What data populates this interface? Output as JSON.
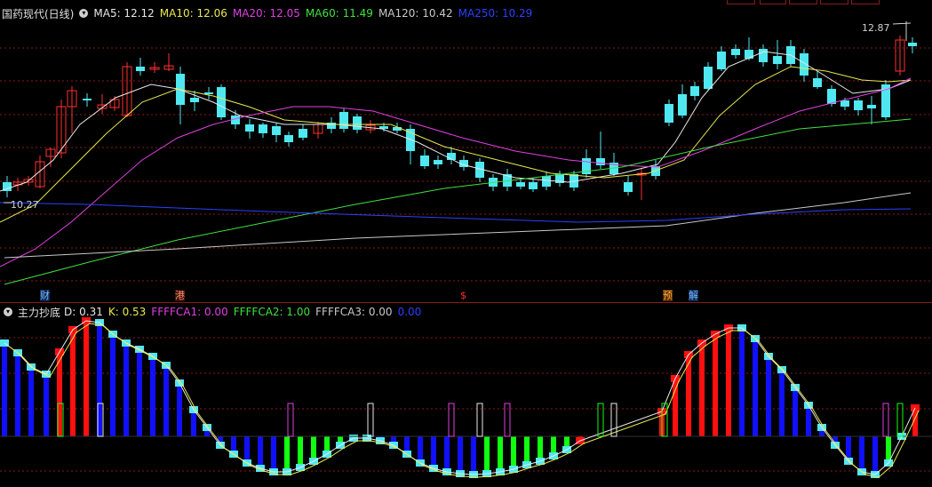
{
  "main_header": {
    "symbol": "国药现代(日线)",
    "indicators": [
      {
        "label": "MA5: 12.12",
        "color": "#e8e8e8"
      },
      {
        "label": "MA10: 12.06",
        "color": "#e8e850"
      },
      {
        "label": "MA20: 12.05",
        "color": "#e040e0"
      },
      {
        "label": "MA60: 11.49",
        "color": "#40e040"
      },
      {
        "label": "MA120: 10.42",
        "color": "#c8c8c8"
      },
      {
        "label": "MA250: 10.29",
        "color": "#2a40ff"
      }
    ]
  },
  "price_labels": {
    "high": "12.87",
    "low": "10.27"
  },
  "event_markers": [
    {
      "text": "财",
      "color": "#7ab8ff",
      "bg": "#0a2a55"
    },
    {
      "text": "港",
      "color": "#ff9060",
      "bg": "#3a1010"
    },
    {
      "text": "$",
      "color": "#ff3030",
      "bg": "#000000"
    },
    {
      "text": "预",
      "color": "#ffb040",
      "bg": "#5a2a00"
    },
    {
      "text": "解",
      "color": "#7ab8ff",
      "bg": "#0a2a55"
    }
  ],
  "sub_header": {
    "name": "主力抄底",
    "indicators": [
      {
        "label": "D: 0.31",
        "color": "#e8e8e8"
      },
      {
        "label": "K: 0.53",
        "color": "#e8e850"
      },
      {
        "label": "FFFFCA1: 0.00",
        "color": "#e040e0"
      },
      {
        "label": "FFFFCA2: 1.00",
        "color": "#40e040"
      },
      {
        "label": "FFFFCA3: 0.00",
        "color": "#c8c8c8"
      },
      {
        "label": "0.00",
        "color": "#2a40ff"
      }
    ]
  },
  "colors": {
    "up": "#ff3030",
    "down": "#50e8f0",
    "grid": "#8b1a1a",
    "bar_red": "#ff1010",
    "bar_blue": "#1010ff",
    "bar_green": "#10ff10"
  }
}
